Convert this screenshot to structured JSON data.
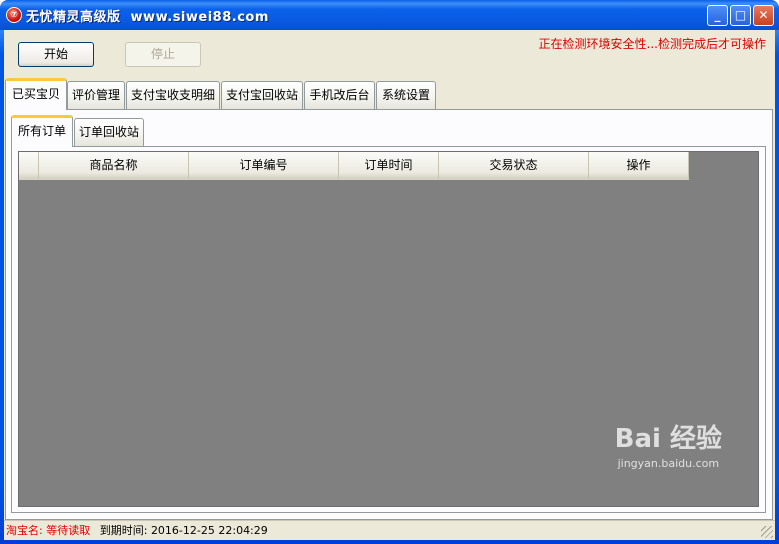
{
  "window": {
    "icon_glyph": "⑦",
    "title": "无忧精灵高级版  www.siwei88.com",
    "minimize_glyph": "_",
    "maximize_glyph": "□",
    "close_glyph": "✕"
  },
  "toolbar": {
    "start_label": "开始",
    "stop_label": "停止",
    "notice": "正在检测环境安全性...检测完成后才可操作"
  },
  "tabs": [
    {
      "label": "已买宝贝",
      "active": true
    },
    {
      "label": "评价管理"
    },
    {
      "label": "支付宝收支明细"
    },
    {
      "label": "支付宝回收站"
    },
    {
      "label": "手机改后台"
    },
    {
      "label": "系统设置"
    }
  ],
  "subtabs": [
    {
      "label": "所有订单",
      "active": true
    },
    {
      "label": "订单回收站"
    }
  ],
  "table": {
    "columns": [
      "",
      "商品名称",
      "订单编号",
      "订单时间",
      "交易状态",
      "操作"
    ],
    "rows": []
  },
  "status": {
    "account_label": "淘宝名:",
    "account_value": "等待读取",
    "expiry_label": "到期时间:",
    "expiry_value": "2016-12-25 22:04:29"
  },
  "watermark": {
    "brand": "Bai 经验",
    "url": "jingyan.baidu.com"
  },
  "colors": {
    "title_bar": "#0a5fe8",
    "client_bg": "#ece9d8",
    "notice_red": "#e00000",
    "grid_bg": "#808080",
    "active_tab_accent": "#ffc83c"
  }
}
